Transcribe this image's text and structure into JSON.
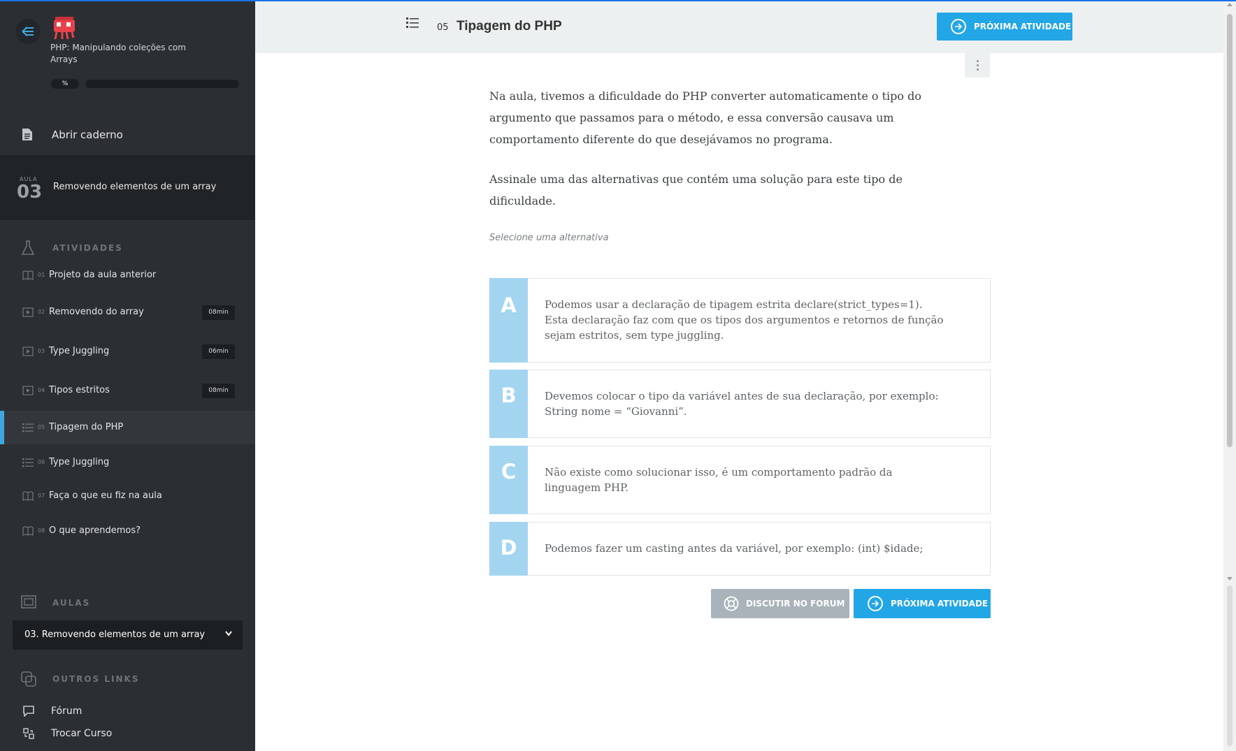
{
  "course": {
    "title": "PHP: Manipulando coleções com Arrays",
    "progress_label": "%",
    "progress": 0
  },
  "sidebar": {
    "notebook_label": "Abrir caderno",
    "aula": {
      "label": "AULA",
      "number": "03",
      "title": "Removendo elementos de um array"
    },
    "activities_heading": "ATIVIDADES",
    "activities": [
      {
        "num": "01",
        "title": "Projeto da aula anterior",
        "icon": "book-icon",
        "duration": ""
      },
      {
        "num": "02",
        "title": "Removendo do array",
        "icon": "video-icon",
        "duration": "08min"
      },
      {
        "num": "03",
        "title": "Type Juggling",
        "icon": "video-icon",
        "duration": "06min"
      },
      {
        "num": "04",
        "title": "Tipos estritos",
        "icon": "video-icon",
        "duration": "08min"
      },
      {
        "num": "05",
        "title": "Tipagem do PHP",
        "icon": "list-icon",
        "duration": ""
      },
      {
        "num": "06",
        "title": "Type Juggling",
        "icon": "list-icon",
        "duration": ""
      },
      {
        "num": "07",
        "title": "Faça o que eu fiz na aula",
        "icon": "book-icon",
        "duration": ""
      },
      {
        "num": "08",
        "title": "O que aprendemos?",
        "icon": "book-icon",
        "duration": ""
      }
    ],
    "aulas_heading": "AULAS",
    "aulas_selected": "03. Removendo elementos de um array",
    "outros_heading": "OUTROS LINKS",
    "links": [
      {
        "label": "Fórum",
        "icon": "forum-icon"
      },
      {
        "label": "Trocar Curso",
        "icon": "switch-course-icon"
      }
    ]
  },
  "header": {
    "num": "05",
    "title": "Tipagem do PHP",
    "next_button": "PRÓXIMA ATIVIDADE"
  },
  "question": {
    "paragraph1": "Na aula, tivemos a dificuldade do PHP converter automaticamente o tipo do argumento que passamos para o método, e essa conversão causava um comportamento diferente do que desejávamos no programa.",
    "paragraph2": "Assinale uma das alternativas que contém uma solução para este tipo de dificuldade.",
    "hint": "Selecione uma alternativa",
    "options": [
      {
        "letter": "A",
        "text": "Podemos usar a declaração de tipagem estrita declare(strict_types=1). Esta declaração faz com que os tipos dos argumentos e retornos de função sejam estritos, sem type juggling."
      },
      {
        "letter": "B",
        "text": "Devemos colocar o tipo da variável antes de sua declaração, por exemplo: String nome = “Giovanni”."
      },
      {
        "letter": "C",
        "text": "Não existe como solucionar isso, é um comportamento padrão da linguagem PHP."
      },
      {
        "letter": "D",
        "text": "Podemos fazer um casting antes da variável, por exemplo: (int) $idade;"
      }
    ]
  },
  "footer_buttons": {
    "forum": "DISCUTIR NO FORUM",
    "next": "PRÓXIMA ATIVIDADE"
  },
  "colors": {
    "sidebar_bg": "#2b2f33",
    "accent": "#23a6e6",
    "option_letter_bg": "#a3d5f0"
  }
}
